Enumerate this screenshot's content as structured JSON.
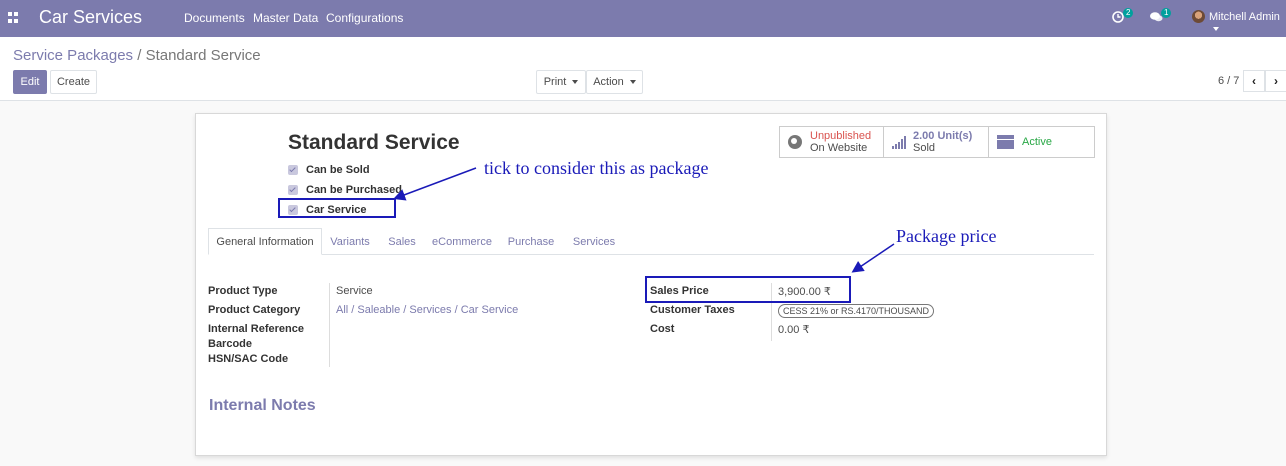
{
  "navbar": {
    "app_title": "Car Services",
    "menu": [
      "Documents",
      "Master Data",
      "Configurations"
    ],
    "activity_count": "2",
    "message_count": "1",
    "user_name": "Mitchell Admin"
  },
  "breadcrumb": {
    "parent": "Service Packages",
    "separator": " / ",
    "current": "Standard Service"
  },
  "toolbar": {
    "edit": "Edit",
    "create": "Create",
    "print": "Print",
    "action": "Action"
  },
  "pager": {
    "text": "6 / 7"
  },
  "product": {
    "name": "Standard Service",
    "checkboxes": [
      "Can be Sold",
      "Can be Purchased",
      "Car Service"
    ]
  },
  "stats": {
    "website_status": "Unpublished",
    "website_sub": "On Website",
    "sold_qty": "2.00 Unit(s)",
    "sold_sub": "Sold",
    "active": "Active"
  },
  "tabs": [
    "General Information",
    "Variants",
    "Sales",
    "eCommerce",
    "Purchase",
    "Services"
  ],
  "left_fields": {
    "labels": [
      "Product Type",
      "Product Category",
      "Internal Reference",
      "Barcode",
      "HSN/SAC Code"
    ],
    "product_type": "Service",
    "product_category": "All / Saleable / Services / Car Service"
  },
  "right_fields": {
    "labels": [
      "Sales Price",
      "Customer Taxes",
      "Cost"
    ],
    "sales_price": "3,900.00 ₹",
    "customer_tax_tag": "CESS 21% or RS.4170/THOUSAND",
    "cost": "0.00 ₹"
  },
  "internal_notes": "Internal Notes",
  "annotations": {
    "package_tick": "tick to consider this as package",
    "package_price": "Package price"
  },
  "colors": {
    "brand": "#7c7bad",
    "annotation": "#1a1ab8",
    "unpublished": "#d9534f",
    "active": "#28a745"
  }
}
